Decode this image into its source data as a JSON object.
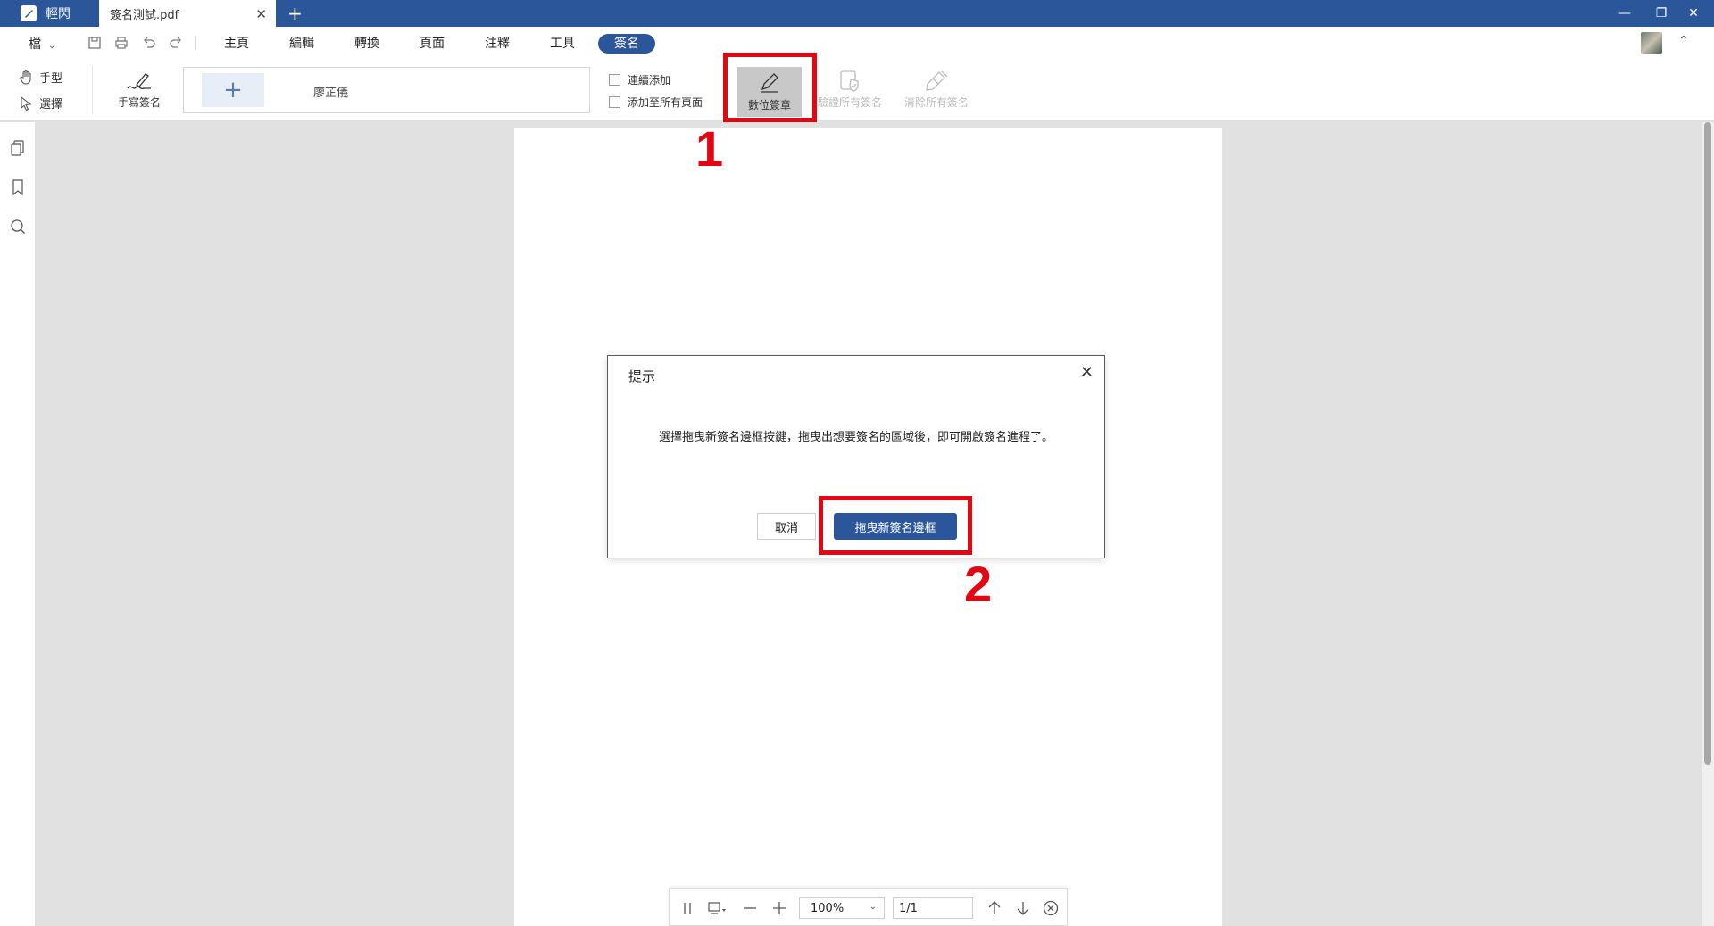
{
  "titlebar": {
    "app_name": "輕閃",
    "doc_tab": "簽名測試.pdf",
    "tab_close": "✕",
    "new_tab": "+",
    "minimize": "—",
    "restore": "❐",
    "close": "✕"
  },
  "menubar": {
    "file": "檔",
    "tabs": [
      "主頁",
      "編輯",
      "轉換",
      "頁面",
      "注釋",
      "工具",
      "簽名"
    ],
    "active_tab": "簽名"
  },
  "ribbon": {
    "hand_tool": "手型",
    "select_tool": "選擇",
    "handwrite_signature": "手寫簽名",
    "signature_add": "+",
    "signature_name": "廖芷儀",
    "continuous_add": "連續添加",
    "add_to_all_pages": "添加至所有頁面",
    "digital_signature": "數位簽章",
    "verify_all": "驗證所有簽名",
    "clear_all": "清除所有簽名"
  },
  "annotations": {
    "step1": "1",
    "step2": "2"
  },
  "dialog": {
    "title": "提示",
    "close": "✕",
    "message": "選擇拖曳新簽名邊框按鍵，拖曳出想要簽名的區域後，即可開啟簽名進程了。",
    "cancel": "取消",
    "primary": "拖曳新簽名邊框"
  },
  "bottombar": {
    "zoom": "100%",
    "page": "1/1"
  },
  "colors": {
    "brand": "#2b579a",
    "annotation_red": "#e30613",
    "active_tool_bg": "#c8c8c8"
  }
}
